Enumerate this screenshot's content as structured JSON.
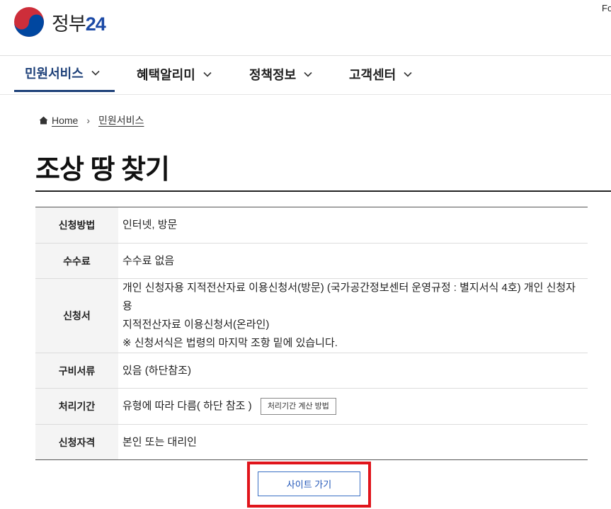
{
  "header": {
    "logo_text": "정부",
    "logo_num": "24",
    "corner_text": "Fo"
  },
  "gnb": [
    {
      "label": "민원서비스",
      "active": true
    },
    {
      "label": "혜택알리미",
      "active": false
    },
    {
      "label": "정책정보",
      "active": false
    },
    {
      "label": "고객센터",
      "active": false
    }
  ],
  "breadcrumb": {
    "home": "Home",
    "current": "민원서비스"
  },
  "page_title": "조상 땅 찾기",
  "info_table": {
    "rows": [
      {
        "label": "신청방법",
        "value": "인터넷, 방문"
      },
      {
        "label": "수수료",
        "value": "수수료 없음"
      },
      {
        "label": "신청서",
        "value_line1": "개인 신청자용 지적전산자료 이용신청서(방문) (국가공간정보센터 운영규정 : 별지서식 4호) 개인 신청자용",
        "value_line2": "지적전산자료 이용신청서(온라인)",
        "value_line3": "※ 신청서식은 법령의 마지막 조항 밑에 있습니다."
      },
      {
        "label": "구비서류",
        "value": "있음 (하단참조)"
      },
      {
        "label": "처리기간",
        "value": "유형에 따라 다름( 하단 참조 )",
        "button": "처리기간 계산 방법"
      },
      {
        "label": "신청자격",
        "value": "본인 또는 대리인"
      }
    ]
  },
  "site_button": "사이트 가기",
  "colors": {
    "brand_blue": "#1c3f78",
    "highlight_red": "#e0141b",
    "button_blue": "#2156b8"
  }
}
